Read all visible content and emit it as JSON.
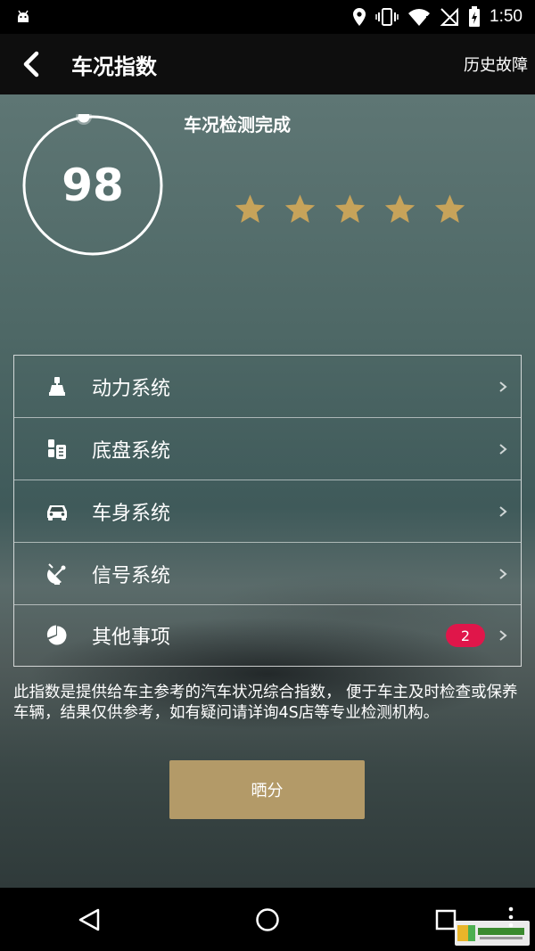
{
  "status_bar": {
    "time": "1:50"
  },
  "app_bar": {
    "title": "车况指数",
    "history_label": "历史故障"
  },
  "score": {
    "value": "98",
    "status": "车况检测完成",
    "stars": 5,
    "max_stars": 5
  },
  "systems": [
    {
      "label": "动力系统",
      "icon": "engine-icon"
    },
    {
      "label": "底盘系统",
      "icon": "chassis-icon"
    },
    {
      "label": "车身系统",
      "icon": "car-body-icon"
    },
    {
      "label": "信号系统",
      "icon": "satellite-icon"
    },
    {
      "label": "其他事项",
      "icon": "pie-icon",
      "badge": "2"
    }
  ],
  "disclaimer": "此指数是提供给车主参考的汽车状况综合指数， 便于车主及时检查或保养车辆，结果仅供参考，如有疑问请详询4S店等专业检测机构。",
  "share_label": "晒分",
  "colors": {
    "accent": "#b39a68",
    "star": "#c7a35a",
    "badge": "#e0164a"
  }
}
